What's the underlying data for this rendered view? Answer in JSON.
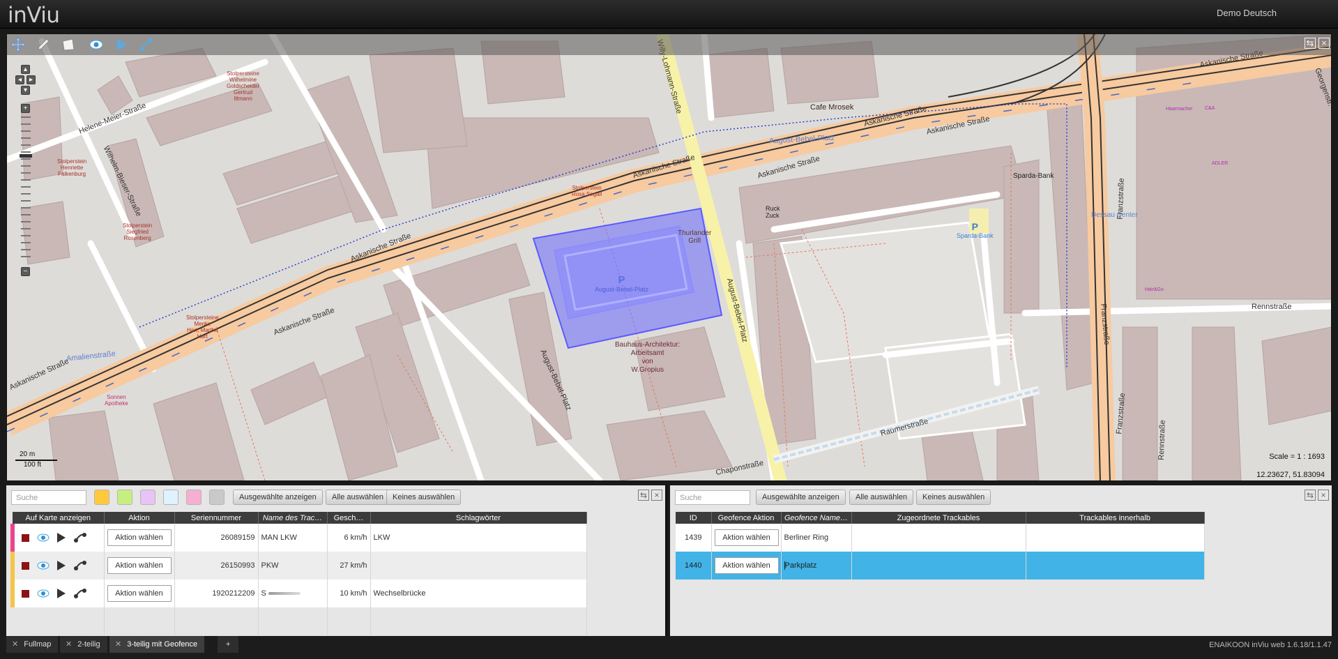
{
  "header": {
    "logo": "inViu",
    "user_menu": "Demo Deutsch"
  },
  "map": {
    "scale": "Scale = 1 : 1693",
    "coordinates": "12.23627, 51.83094",
    "scale_metric": "20 m",
    "scale_imperial": "100 ft",
    "labels": {
      "askanische_1": "Askanische Straße",
      "askanische_2": "Askanische Straße",
      "askanische_3": "Askanische Straße",
      "askanische_4": "Askanische Straße",
      "askanische_5": "Askanische Straße",
      "askanische_6": "Askanische Straße",
      "askanische_7": "Askanische Straße",
      "helene": "Helene-Meier-Straße",
      "wilhelm": "Wilhelm-Bieser-Straße",
      "willy": "Willy-Lohmann-Straße",
      "august_bebel_platz_n": "August-Bebel-Platz",
      "august_bebel_platz_v": "August-Bebel-Platz",
      "august_bebel_platz_w": "August-Bebel-Platz",
      "parking": "August-Bebel-Platz",
      "amalien": "Amalienstraße",
      "franz_1": "Franzstraße",
      "franz_2": "Franzstraße",
      "franz_3": "Franzstraße",
      "renn_1": "Rennstraße",
      "renn_2": "Rennstraße",
      "raumer": "Raumerstraße",
      "chapon": "Chaponstraße",
      "george": "Georgenstr.",
      "cafe": "Cafe Mrosek",
      "sparda": "Sparda-Bank",
      "sparda_p": "Sparda-Bank",
      "dessau_center": "Dessau Center",
      "ruck": "Ruck\nZuck",
      "thurlander": "Thurlander\nGrill",
      "bauhaus": "Bauhaus-Architektur:\nArbeitsamt\nvon\nW.Gropius",
      "sonnen": "Sonnen\nApotheke",
      "stolper_falkenburg": "Stolperstein\nHenriette\nFalkenburg",
      "stolper_rosenberg": "Stolperstein\nSiegfried\nRosenberg",
      "stolper_segall": "Stolperstein\nRosa Segall",
      "stolper_goldscheider": "Stolpersteine\nWilhelmine\nGoldscheider\nGertrud\nIttmann",
      "stolper_hart": "Stolpersteine\nMenke\nHart, Martha\nHart",
      "haarmacher": "Haarmacher",
      "adler": "ADLER",
      "cna": "C&A",
      "hairgo": "Hair&Go"
    }
  },
  "left_panel": {
    "search_placeholder": "Suche",
    "show_selected": "Ausgewählte anzeigen",
    "select_all": "Alle auswählen",
    "select_none": "Keines auswählen",
    "color_filters": [
      "#ffc93c",
      "#c7ef7f",
      "#e8c3f5",
      "#dff2ff",
      "#f7aed3",
      "#c9c9c9"
    ],
    "columns": [
      "Auf Karte anzeigen",
      "Aktion",
      "Seriennummer",
      "Name des Trac…",
      "Gesch…",
      "Schlagwörter"
    ],
    "rows": [
      {
        "accent": "#e8458f",
        "action": "Aktion wählen",
        "serial": "26089159",
        "name": "MAN LKW",
        "speed": "6 km/h",
        "tags": "LKW"
      },
      {
        "accent": "#f3c64a",
        "action": "Aktion wählen",
        "serial": "26150993",
        "name": "PKW",
        "speed": "27 km/h",
        "tags": ""
      },
      {
        "accent": "#f3c64a",
        "action": "Aktion wählen",
        "serial": "1920212209",
        "name": "S",
        "speed": "10 km/h",
        "tags": "Wechselbrücke"
      }
    ]
  },
  "right_panel": {
    "search_placeholder": "Suche",
    "show_selected": "Ausgewählte anzeigen",
    "select_all": "Alle auswählen",
    "select_none": "Keines auswählen",
    "columns": [
      "ID",
      "Geofence Aktion",
      "Geofence Name…",
      "Zugeordnete Trackables",
      "Trackables innerhalb"
    ],
    "rows": [
      {
        "id": "1439",
        "action": "Aktion wählen",
        "name": "Berliner Ring",
        "assigned": "",
        "inside": ""
      },
      {
        "id": "1440",
        "action": "Aktion wählen",
        "name": "Parkplatz",
        "assigned": "",
        "inside": ""
      }
    ]
  },
  "tabs": [
    {
      "label": "Fullmap",
      "active": false
    },
    {
      "label": "2-teilig",
      "active": false
    },
    {
      "label": "3-teilig mit Geofence",
      "active": true
    }
  ],
  "tab_add": "+",
  "version": "ENAIKOON inViu web 1.6.18/1.1.47"
}
